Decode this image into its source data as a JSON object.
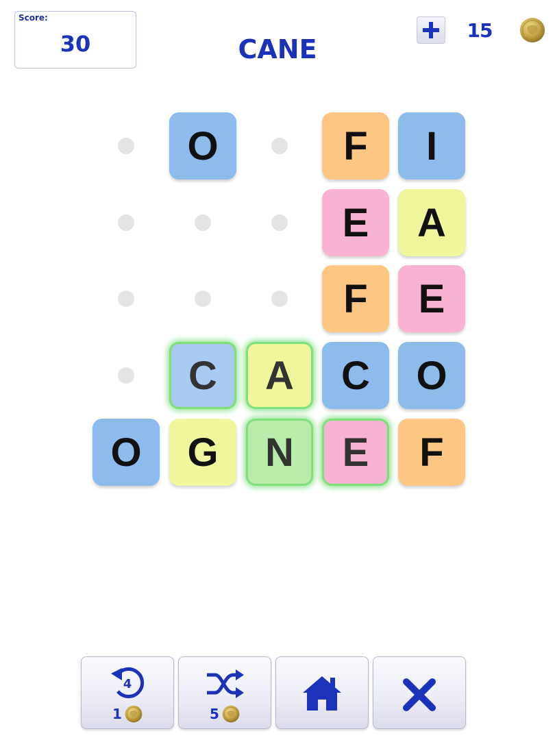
{
  "header": {
    "score_label": "Score:",
    "score_value": "30",
    "current_word": "CANE",
    "coin_count": "15"
  },
  "board": {
    "tiles": [
      {
        "letter": "O",
        "row": 0,
        "col": 1,
        "color": "blue",
        "selected": false
      },
      {
        "letter": "F",
        "row": 0,
        "col": 3,
        "color": "orange",
        "selected": false
      },
      {
        "letter": "I",
        "row": 0,
        "col": 4,
        "color": "blue",
        "selected": false
      },
      {
        "letter": "E",
        "row": 1,
        "col": 3,
        "color": "pink",
        "selected": false
      },
      {
        "letter": "A",
        "row": 1,
        "col": 4,
        "color": "yellow",
        "selected": false
      },
      {
        "letter": "F",
        "row": 2,
        "col": 3,
        "color": "orange",
        "selected": false
      },
      {
        "letter": "E",
        "row": 2,
        "col": 4,
        "color": "pink",
        "selected": false
      },
      {
        "letter": "C",
        "row": 3,
        "col": 1,
        "color": "blue-l",
        "selected": true
      },
      {
        "letter": "A",
        "row": 3,
        "col": 2,
        "color": "yellow",
        "selected": true
      },
      {
        "letter": "C",
        "row": 3,
        "col": 3,
        "color": "blue",
        "selected": false
      },
      {
        "letter": "O",
        "row": 3,
        "col": 4,
        "color": "blue",
        "selected": false
      },
      {
        "letter": "O",
        "row": 4,
        "col": 0,
        "color": "blue",
        "selected": false
      },
      {
        "letter": "G",
        "row": 4,
        "col": 1,
        "color": "yellow",
        "selected": false
      },
      {
        "letter": "N",
        "row": 4,
        "col": 2,
        "color": "green",
        "selected": true
      },
      {
        "letter": "E",
        "row": 4,
        "col": 3,
        "color": "pink",
        "selected": true
      },
      {
        "letter": "F",
        "row": 4,
        "col": 4,
        "color": "orange",
        "selected": false
      }
    ],
    "empty_cells": [
      {
        "row": 0,
        "col": 0
      },
      {
        "row": 0,
        "col": 2
      },
      {
        "row": 1,
        "col": 0
      },
      {
        "row": 1,
        "col": 1
      },
      {
        "row": 1,
        "col": 2
      },
      {
        "row": 2,
        "col": 0
      },
      {
        "row": 2,
        "col": 1
      },
      {
        "row": 2,
        "col": 2
      },
      {
        "row": 3,
        "col": 0
      }
    ]
  },
  "toolbar": {
    "undo": {
      "icon": "undo-icon",
      "badge": "4",
      "cost": "1"
    },
    "shuffle": {
      "icon": "shuffle-icon",
      "cost": "5"
    },
    "home": {
      "icon": "home-icon"
    },
    "close": {
      "icon": "close-icon"
    }
  },
  "colors": {
    "accent": "#1a33b8",
    "blue": "#8dbbea",
    "blue-l": "#a9cbf2",
    "orange": "#fdc783",
    "pink": "#f9b3d2",
    "yellow": "#eff69c",
    "green": "#b9ecab",
    "selected_glow": "#7ee07a",
    "coin": "#c9a84a"
  }
}
